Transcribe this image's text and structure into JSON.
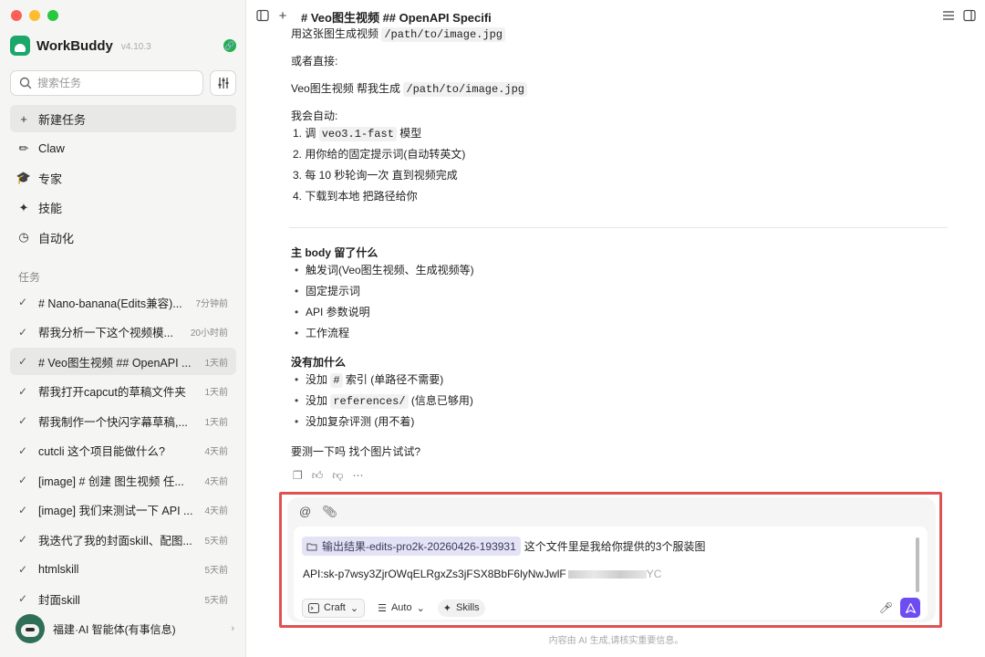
{
  "window": {
    "title": "# Veo图生视频 ## OpenAPI Specifi"
  },
  "sidebar": {
    "brand": {
      "name": "WorkBuddy",
      "version": "v4.10.3"
    },
    "search": {
      "placeholder": "搜索任务"
    },
    "nav": [
      {
        "label": "新建任务",
        "icon": "plus-icon"
      },
      {
        "label": "Claw",
        "icon": "claw-icon"
      },
      {
        "label": "专家",
        "icon": "graduation-cap-icon"
      },
      {
        "label": "技能",
        "icon": "magic-wand-icon"
      },
      {
        "label": "自动化",
        "icon": "clock-icon"
      }
    ],
    "tasks_label": "任务",
    "tasks": [
      {
        "title": "# Nano-banana(Edits兼容)...",
        "time": "7分钟前"
      },
      {
        "title": "帮我分析一下这个视频模...",
        "time": "20小时前"
      },
      {
        "title": "# Veo图生视频 ## OpenAPI ...",
        "time": "1天前"
      },
      {
        "title": "帮我打开capcut的草稿文件夹",
        "time": "1天前"
      },
      {
        "title": "帮我制作一个快闪字幕草稿,...",
        "time": "1天前"
      },
      {
        "title": "cutcli 这个项目能做什么?",
        "time": "4天前"
      },
      {
        "title": "[image] # 创建 图生视频 任...",
        "time": "4天前"
      },
      {
        "title": "[image] 我们来测试一下 API ...",
        "time": "4天前"
      },
      {
        "title": "我迭代了我的封面skill、配图...",
        "time": "5天前"
      },
      {
        "title": "htmlskill",
        "time": "5天前"
      },
      {
        "title": "封面skill",
        "time": "5天前"
      }
    ],
    "user": {
      "name": "福建·AI 智能体(有事信息)"
    }
  },
  "content": {
    "l0_pre": "用这张图生成视频",
    "l0_code": "/path/to/image.jpg",
    "l1": "或者直接:",
    "l2_pre": "Veo图生视频 帮我生成",
    "l2_code": "/path/to/image.jpg",
    "l3": "我会自动:",
    "s1_pre": "1. 调",
    "s1_code": "veo3.1-fast",
    "s1_post": "模型",
    "s2": "2. 用你给的固定提示词(自动转英文)",
    "s3": "3. 每 10 秒轮询一次 直到视频完成",
    "s4": "4. 下载到本地 把路径给你",
    "h1": "主 body 留了什么",
    "b1": "触发词(Veo图生视频、生成视频等)",
    "b2": "固定提示词",
    "b3": "API 参数说明",
    "b4": "工作流程",
    "h2": "没有加什么",
    "c1_pre": "没加",
    "c1_code": "#",
    "c1_post": "索引 (单路径不需要)",
    "c2_pre": "没加",
    "c2_code": "references/",
    "c2_post": "(信息已够用)",
    "c3": "没加复杂评测 (用不着)",
    "q": "要测一下吗 找个图片试试?"
  },
  "composer": {
    "folder_chip": "输出结果-edits-pro2k-20260426-193931",
    "line1_text": "这个文件里是我给你提供的3个服装图",
    "line2_text": "API:sk-p7wsy3ZjrOWqELRgxZs3jFSX8BbF6lyNwJwlF",
    "line2_tail": "YC",
    "craft_label": "Craft",
    "auto_label": "Auto",
    "skills_label": "Skills"
  },
  "footer": "内容由 AI 生成,请核实重要信息。",
  "colors": {
    "accent": "#6d4cf2",
    "brand": "#1aa86a",
    "highlight_frame": "#e05252"
  }
}
